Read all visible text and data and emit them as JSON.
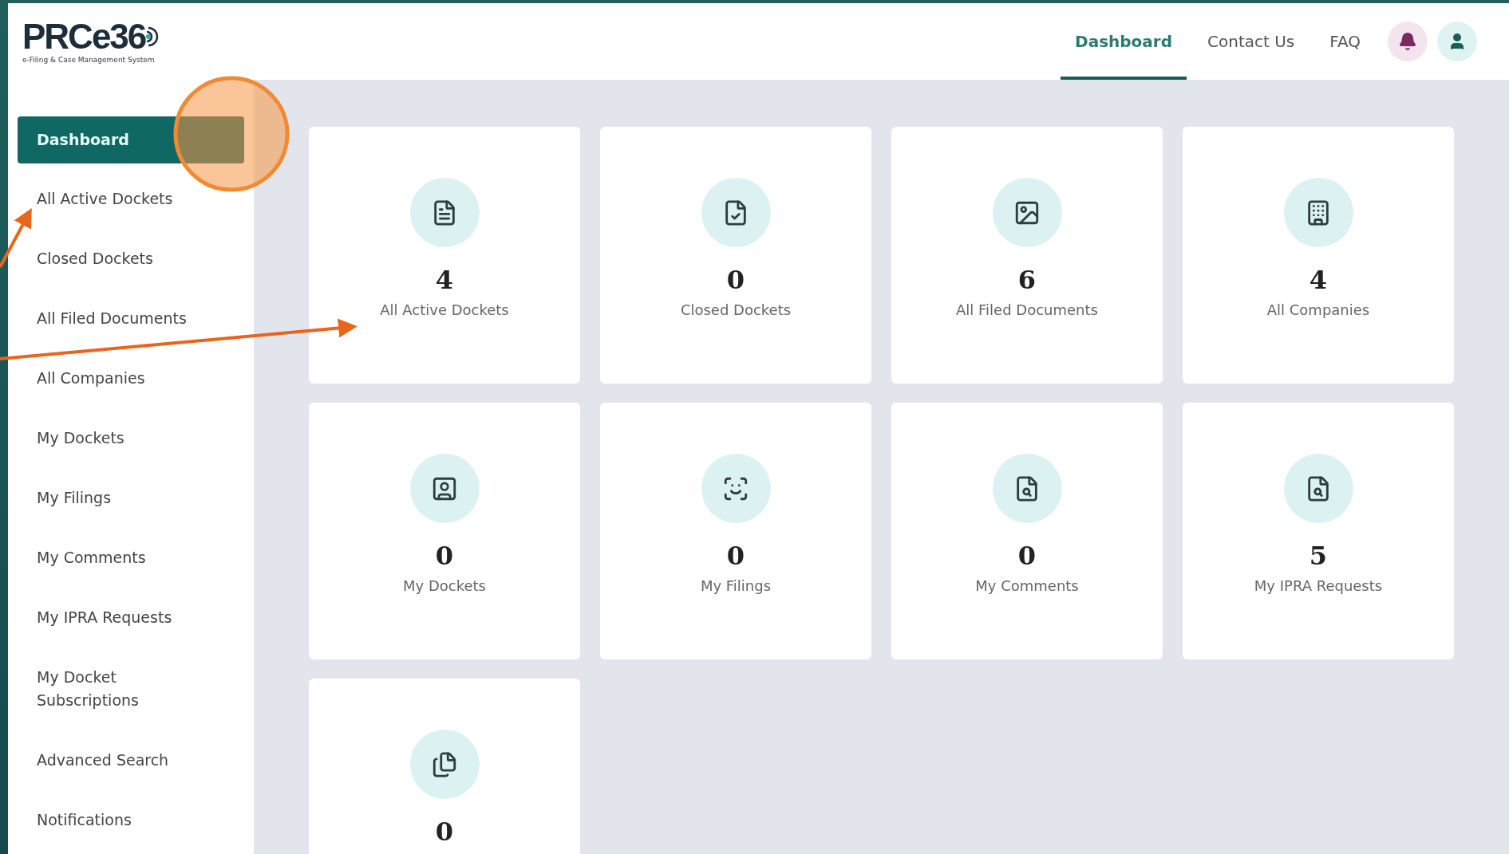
{
  "logo": {
    "name": "PRCe36",
    "tagline": "e-Filing & Case Management System"
  },
  "nav": [
    {
      "label": "Dashboard",
      "selected": true
    },
    {
      "label": "Contact Us",
      "selected": false
    },
    {
      "label": "FAQ",
      "selected": false
    }
  ],
  "sidebar": {
    "items": [
      {
        "label": "Dashboard",
        "selected": true
      },
      {
        "label": "All Active Dockets",
        "selected": false
      },
      {
        "label": "Closed Dockets",
        "selected": false
      },
      {
        "label": "All Filed Documents",
        "selected": false
      },
      {
        "label": "All Companies",
        "selected": false
      },
      {
        "label": "My Dockets",
        "selected": false
      },
      {
        "label": "My Filings",
        "selected": false
      },
      {
        "label": "My Comments",
        "selected": false
      },
      {
        "label": "My IPRA Requests",
        "selected": false
      },
      {
        "label": "My Docket Subscriptions",
        "selected": false
      },
      {
        "label": "Advanced Search",
        "selected": false
      },
      {
        "label": "Notifications",
        "selected": false
      }
    ]
  },
  "cards": [
    {
      "count": "4",
      "label": "All Active Dockets"
    },
    {
      "count": "0",
      "label": "Closed Dockets"
    },
    {
      "count": "6",
      "label": "All Filed Documents"
    },
    {
      "count": "4",
      "label": "All Companies"
    },
    {
      "count": "0",
      "label": "My Dockets"
    },
    {
      "count": "0",
      "label": "My Filings"
    },
    {
      "count": "0",
      "label": "My Comments"
    },
    {
      "count": "5",
      "label": "My IPRA Requests"
    },
    {
      "count": "0"
    }
  ]
}
